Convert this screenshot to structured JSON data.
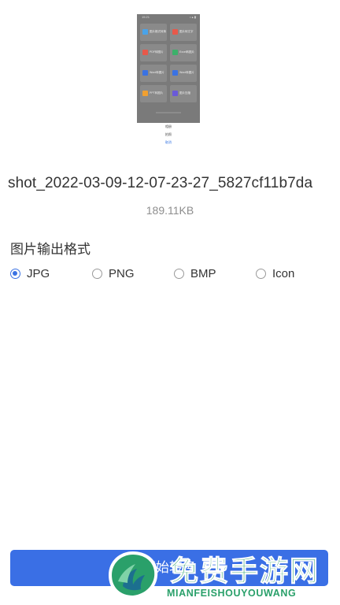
{
  "preview": {
    "status_time": "15:21",
    "status_right": "• ▴ ▮",
    "tiles": [
      {
        "label": "图片格式转换",
        "color": "#4aa3e8"
      },
      {
        "label": "图片转文字",
        "color": "#e8584a"
      },
      {
        "label": "PDF转图片",
        "color": "#e8584a"
      },
      {
        "label": "Excel转图片",
        "color": "#3cb06a"
      },
      {
        "label": "Word转图片",
        "color": "#3a72e3"
      },
      {
        "label": "Word转图片",
        "color": "#3a72e3"
      },
      {
        "label": "PPT转图片",
        "color": "#f0a030"
      },
      {
        "label": "图片压缩",
        "color": "#6a5ad8"
      }
    ],
    "sheet": [
      "相册",
      "拍照",
      "取消"
    ]
  },
  "file": {
    "name": "shot_2022-03-09-12-07-23-27_5827cf11b7da",
    "size": "189.11KB"
  },
  "format": {
    "title": "图片输出格式",
    "selected": "JPG",
    "options": [
      "JPG",
      "PNG",
      "BMP",
      "Icon"
    ]
  },
  "start_button": "开始转换",
  "watermark": {
    "cn": "免费手游网",
    "en": "MIANFEISHOUYOUWANG"
  },
  "colors": {
    "accent": "#3a72e3",
    "button": "#3a6fe5",
    "watermark": "#2aa06a"
  }
}
